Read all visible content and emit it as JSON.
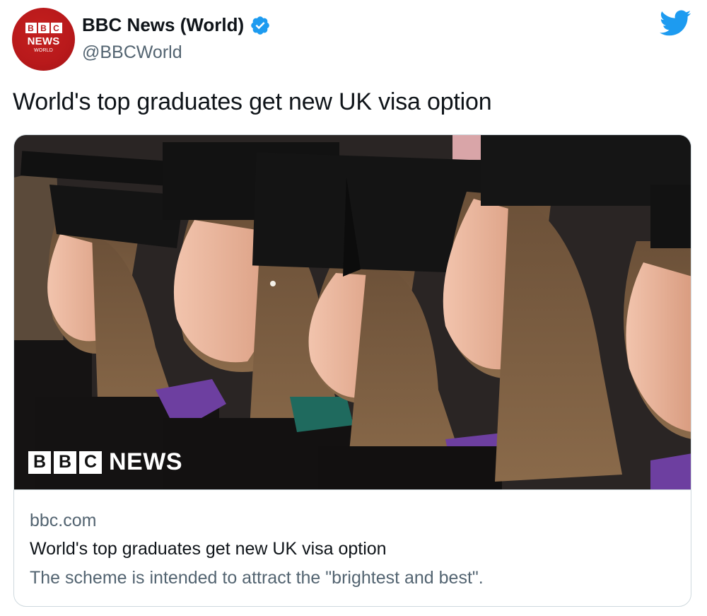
{
  "author": {
    "display_name": "BBC News (World)",
    "handle": "@BBCWorld",
    "verified": true,
    "avatar": {
      "blocks": [
        "B",
        "B",
        "C"
      ],
      "line1": "NEWS",
      "line2": "WORLD"
    }
  },
  "tweet": {
    "text": "World's top graduates get new UK visa option"
  },
  "card": {
    "image_alt": "Smiling female graduates in mortarboards and gowns",
    "watermark": {
      "blocks": [
        "B",
        "B",
        "C"
      ],
      "word": "NEWS"
    },
    "domain": "bbc.com",
    "title": "World's top graduates get new UK visa option",
    "description": "The scheme is intended to attract the \"brightest and best\"."
  },
  "icons": {
    "platform": "twitter-bird-icon",
    "verified": "verified-badge-icon"
  },
  "colors": {
    "brand_red": "#b8191b",
    "twitter_blue": "#1d9bf0",
    "text_primary": "#0f1419",
    "text_secondary": "#536471",
    "border": "#cfd9de"
  }
}
